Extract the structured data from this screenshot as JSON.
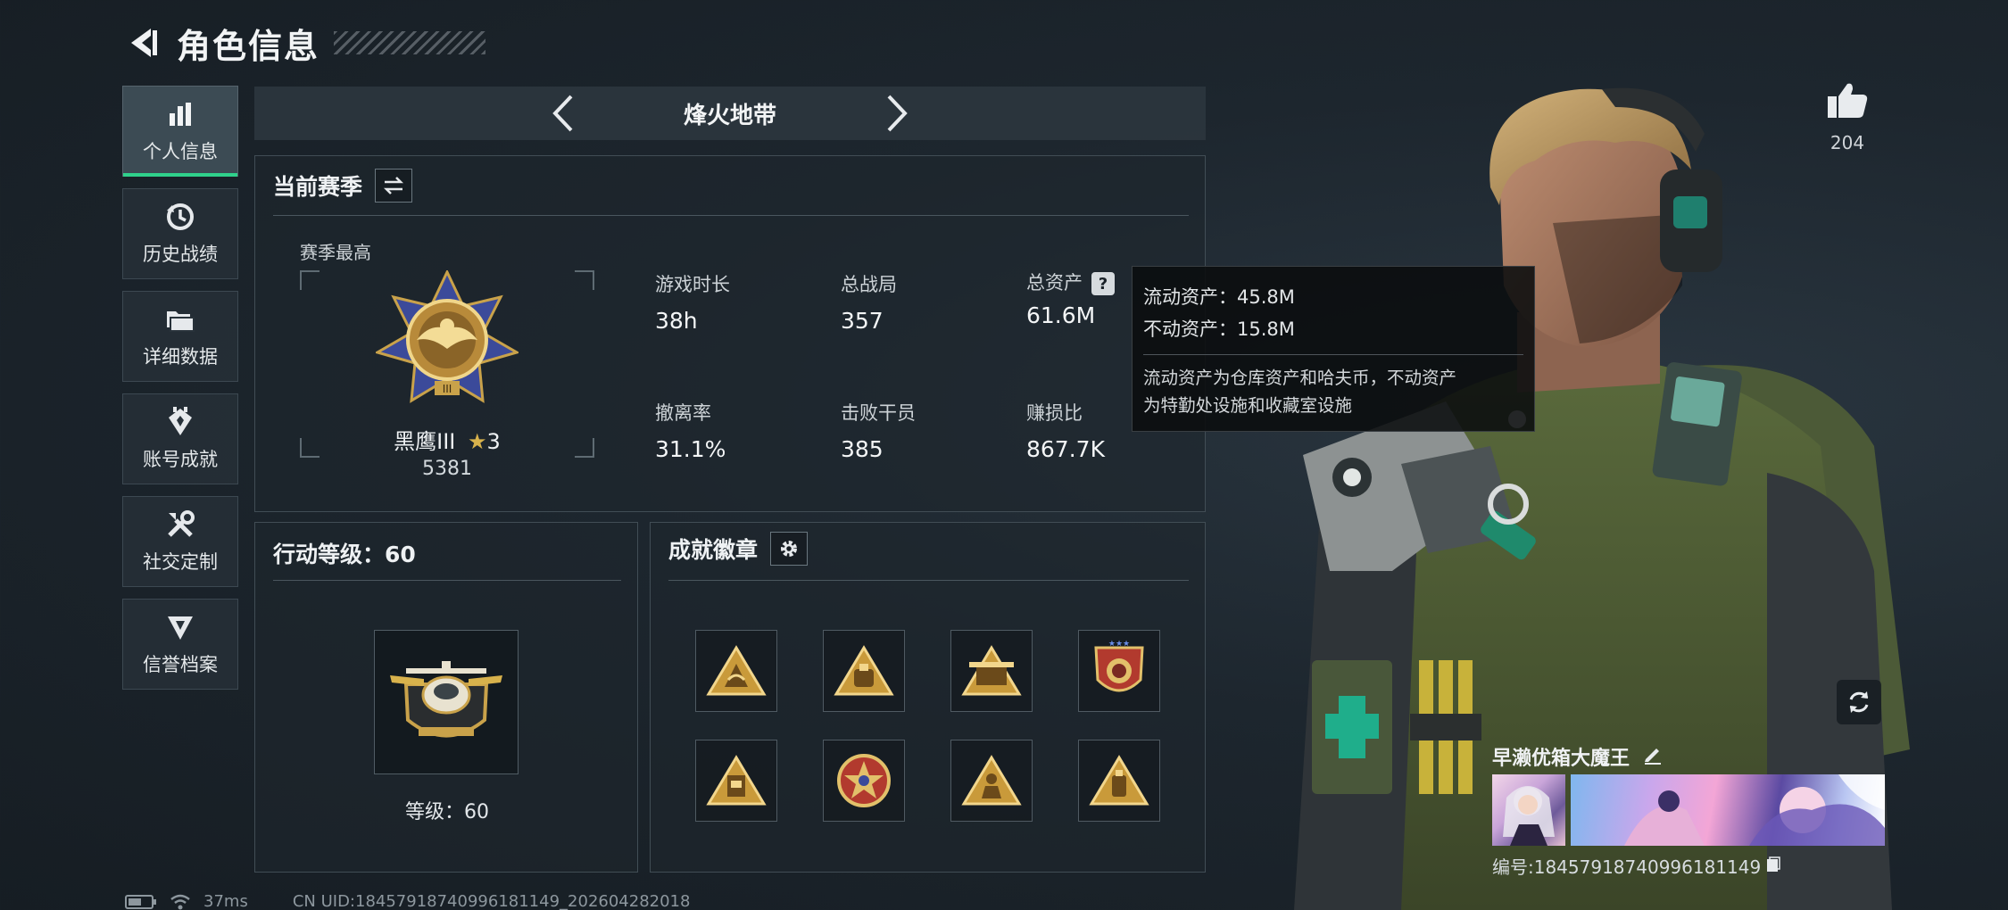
{
  "header": {
    "title": "角色信息"
  },
  "sidebar": {
    "items": [
      {
        "label": "个人信息",
        "icon": "bar-chart-icon",
        "active": true
      },
      {
        "label": "历史战绩",
        "icon": "history-icon"
      },
      {
        "label": "详细数据",
        "icon": "folder-icon"
      },
      {
        "label": "账号成就",
        "icon": "achievement-icon"
      },
      {
        "label": "社交定制",
        "icon": "tools-icon"
      },
      {
        "label": "信誉档案",
        "icon": "reputation-icon"
      }
    ]
  },
  "map_selector": {
    "name": "烽火地带"
  },
  "season": {
    "title": "当前赛季",
    "best_label": "赛季最高",
    "rank_name": "黑鹰III",
    "rank_stars": "3",
    "rank_score": "5381",
    "stats": [
      {
        "label": "游戏时长",
        "value": "38h"
      },
      {
        "label": "总战局",
        "value": "357"
      },
      {
        "label": "总资产",
        "value": "61.6M"
      },
      {
        "label": "撤离率",
        "value": "31.1%"
      },
      {
        "label": "击败干员",
        "value": "385"
      },
      {
        "label": "赚损比",
        "value": "867.7K"
      }
    ]
  },
  "tooltip": {
    "liquid": "流动资产：45.8M",
    "fixed": "不动资产：15.8M",
    "note_line1": "流动资产为仓库资产和哈夫币，不动资产",
    "note_line2": "为特勤处设施和收藏室设施"
  },
  "action_level": {
    "title": "行动等级：60",
    "level_text": "等级：60"
  },
  "achievements": {
    "title": "成就徽章",
    "badges": [
      "badge-triangle-hands",
      "badge-triangle-bag",
      "badge-triangle-crate",
      "badge-shield-stars",
      "badge-triangle-box",
      "badge-round-star",
      "badge-triangle-soldier",
      "badge-triangle-canister"
    ]
  },
  "player": {
    "likes": "204",
    "name": "早濑优箱大魔王",
    "id_text": "编号:18457918740996181149"
  },
  "status_bar": {
    "ping": "37ms",
    "uid": "CN UID:18457918740996181149_202604282018"
  },
  "colors": {
    "accent": "#2fd18c",
    "gold": "#c9a24a",
    "panel_border": "#414d55"
  }
}
